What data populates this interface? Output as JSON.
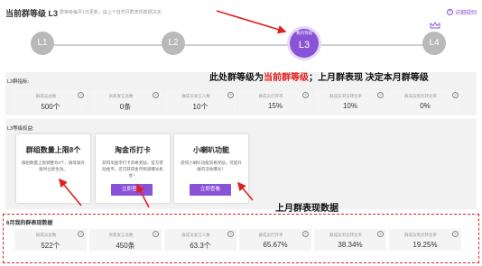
{
  "header": {
    "title": "当前群等级 L3",
    "description": "群等级每月1日更新，由上个自然月群表现数据决定",
    "rule_link": "详细规则"
  },
  "levels": [
    {
      "label": "L1"
    },
    {
      "label": "L2"
    },
    {
      "label": "L3",
      "tag": "我的等级",
      "current": true
    },
    {
      "label": "L4"
    }
  ],
  "indicators": {
    "title": "L3群指标:",
    "items": [
      {
        "label": "群成员总数",
        "value": "500个"
      },
      {
        "label": "商家发言总数",
        "value": "0条"
      },
      {
        "label": "群成员发言人数",
        "value": "10个"
      },
      {
        "label": "群成员打开率",
        "value": "15%"
      },
      {
        "label": "群成员浏览转化率",
        "value": "10%"
      },
      {
        "label": "群成员购买转化率",
        "value": "0%"
      }
    ]
  },
  "annotation_top": {
    "prefix": "此处群等级为",
    "highlight": "当前群等级",
    "suffix": "；上月群表现 决定本月群等级"
  },
  "benefits": {
    "title": "L3等级权益:",
    "items": [
      {
        "title": "群组数量上限8个",
        "desc": "群组数量上限调整为8个，群等级升级时立即生效。"
      },
      {
        "title": "淘金币打卡",
        "desc": "获得淘金币打卡资格奖励，官方赞助金币，还可获得金币频道曝光机会！",
        "button": "立即查看"
      },
      {
        "title": "小喇叭功能",
        "desc": "获得小喇叭功能资格奖励，可提升群内活动曝光！",
        "button": "立即查看"
      }
    ]
  },
  "annotation_bottom": "上月群表现数据",
  "last_month": {
    "title": "6月我的群表现数据",
    "items": [
      {
        "label": "群成员总数",
        "value": "522个"
      },
      {
        "label": "商家发言总数",
        "value": "450条"
      },
      {
        "label": "群成员发言人数",
        "value": "63.3个"
      },
      {
        "label": "群成员打开率",
        "value": "65.67%"
      },
      {
        "label": "群成员浏览转化率",
        "value": "38.34%"
      },
      {
        "label": "群成员购买转化率",
        "value": "19.25%"
      }
    ]
  },
  "colors": {
    "accent": "#8a52d6",
    "annotation": "#e02020",
    "inactive_level": "#b9b9b9"
  }
}
